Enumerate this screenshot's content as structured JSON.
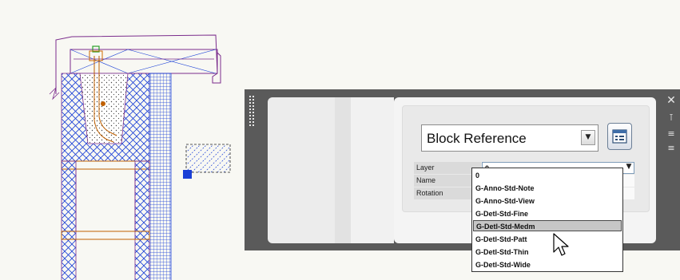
{
  "palette": {
    "object_type": "Block Reference",
    "properties": [
      {
        "label": "Layer",
        "value": "0"
      },
      {
        "label": "Name",
        "value": ""
      },
      {
        "label": "Rotation",
        "value": ""
      }
    ]
  },
  "layer_dropdown": {
    "options": [
      "0",
      "G-Anno-Std-Note",
      "G-Anno-Std-View",
      "G-Detl-Std-Fine",
      "G-Detl-Std-Medm",
      "G-Detl-Std-Patt",
      "G-Detl-Std-Thin",
      "G-Detl-Std-Wide"
    ],
    "highlighted": "G-Detl-Std-Medm"
  },
  "icons": {
    "close": "close-icon",
    "autohide": "autohide-icon",
    "properties_menu": "properties-menu-icon",
    "quick_select": "quick-select-icon",
    "dropdown_arrow": "chevron-down-icon",
    "cursor": "mouse-pointer-icon"
  },
  "colors": {
    "drawing_outline": "#7b2d8c",
    "hatch_blue": "#1a3fd6",
    "grip": "#1a3fd6",
    "palette_frame": "#5a5a5a",
    "highlight": "#c6c6c6"
  }
}
